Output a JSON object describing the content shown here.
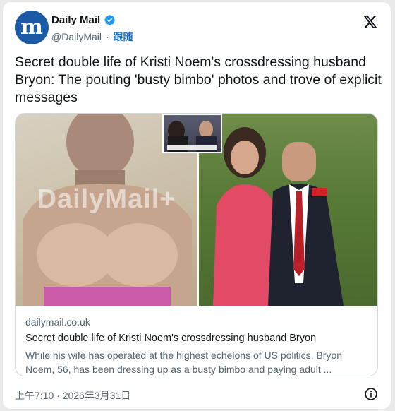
{
  "author": {
    "display_name": "Daily Mail",
    "handle": "@DailyMail",
    "separator": "·",
    "follow_label": "跟随",
    "avatar_letter": "m",
    "avatar_color": "#1d5aa6",
    "verified_color": "#1d9bf0"
  },
  "tweet": {
    "text": "Secret double life of Kristi Noem's crossdressing husband Bryon: The pouting 'busty bimbo' photos and trove of explicit messages"
  },
  "link_card": {
    "watermark": "DailyMail+",
    "domain": "dailymail.co.uk",
    "title": "Secret double life of Kristi Noem's crossdressing husband Bryon",
    "description": "While his wife has operated at the highest echelons of US politics, Bryon Noem, 56, has been dressing up as a busty bimbo and paying adult ..."
  },
  "footer": {
    "timestamp": "上午7:10 · 2026年3月31日"
  },
  "icons": [
    "verified-badge-icon",
    "x-logo-icon",
    "info-icon"
  ]
}
